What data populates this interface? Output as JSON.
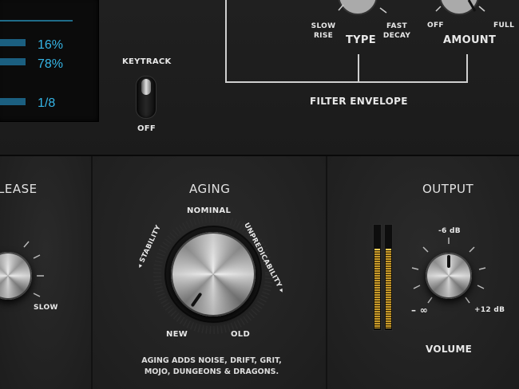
{
  "display": {
    "rows": [
      "16%",
      "78%",
      "1/8"
    ]
  },
  "keytrack": {
    "label": "KEYTRACK",
    "off_label": "OFF"
  },
  "filter_envelope": {
    "title": "FILTER ENVELOPE",
    "type_label": "TYPE",
    "type_min": "SLOW RISE",
    "type_max": "FAST DECAY",
    "amount_label": "AMOUNT",
    "amount_min": "OFF",
    "amount_max": "FULL"
  },
  "release": {
    "title": "LEASE",
    "max_label": "SLOW"
  },
  "aging": {
    "title": "AGING",
    "top_label": "NOMINAL",
    "left_label": "◂ STABILITY",
    "right_label": "UNPREDICABILITY ▸",
    "min_label": "NEW",
    "max_label": "OLD",
    "note_line1": "AGING ADDS NOISE, DRIFT, GRIT,",
    "note_line2": "MOJO, DUNGEONS & DRAGONS."
  },
  "output": {
    "title": "OUTPUT",
    "top_label": "-6 dB",
    "min_label": "– ∞",
    "max_label": "+12 dB",
    "knob_label": "VOLUME"
  },
  "colors": {
    "accent": "#35b5e6",
    "meter": "#c89a2a"
  }
}
